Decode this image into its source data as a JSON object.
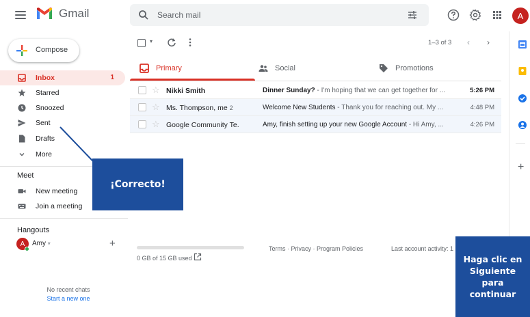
{
  "header": {
    "app_name": "Gmail",
    "search_placeholder": "Search mail",
    "account_initial": "A"
  },
  "sidebar": {
    "compose_label": "Compose",
    "items": [
      {
        "label": "Inbox",
        "count": "1",
        "icon": "inbox-icon",
        "active": true
      },
      {
        "label": "Starred",
        "icon": "star-icon"
      },
      {
        "label": "Snoozed",
        "icon": "clock-icon"
      },
      {
        "label": "Sent",
        "icon": "send-icon"
      },
      {
        "label": "Drafts",
        "icon": "draft-icon"
      },
      {
        "label": "More",
        "icon": "chevron-down-icon"
      }
    ],
    "meet": {
      "title": "Meet",
      "items": [
        {
          "label": "New meeting",
          "icon": "video-icon"
        },
        {
          "label": "Join a meeting",
          "icon": "keyboard-icon"
        }
      ]
    },
    "hangouts": {
      "title": "Hangouts",
      "user_initial": "A",
      "user_name": "Amy",
      "no_chats": "No recent chats",
      "start_new": "Start a new one"
    }
  },
  "toolbar": {
    "pagination": "1–3 of 3"
  },
  "tabs": [
    {
      "label": "Primary",
      "icon": "inbox-icon",
      "active": true
    },
    {
      "label": "Social",
      "icon": "people-icon"
    },
    {
      "label": "Promotions",
      "icon": "tag-icon"
    }
  ],
  "emails": [
    {
      "sender": "Nikki Smith",
      "count": "",
      "subject": "Dinner Sunday?",
      "preview": " - I'm hoping that we can get together for ...",
      "time": "5:26 PM",
      "unread": true
    },
    {
      "sender": "Ms. Thompson, me",
      "count": "2",
      "subject": "Welcome New Students",
      "preview": " - Thank you for reaching out. My ...",
      "time": "4:48 PM",
      "unread": false
    },
    {
      "sender": "Google Community Te.",
      "count": "",
      "subject": "Amy, finish setting up your new Google Account",
      "preview": " - Hi Amy, ...",
      "time": "4:26 PM",
      "unread": false
    }
  ],
  "footer": {
    "storage": "0 GB of 15 GB used",
    "storage_used_fraction": 0,
    "links": "Terms · Privacy · Program Policies",
    "last_activity": "Last account activity: 1"
  },
  "tutorial": {
    "callout": "¡Correcto!",
    "next_prompt": "Haga clic en Siguiente para continuar"
  },
  "colors": {
    "accent_red": "#d93025",
    "tutorial_blue": "#1d4e9c",
    "read_row_bg": "#f2f6fc"
  }
}
